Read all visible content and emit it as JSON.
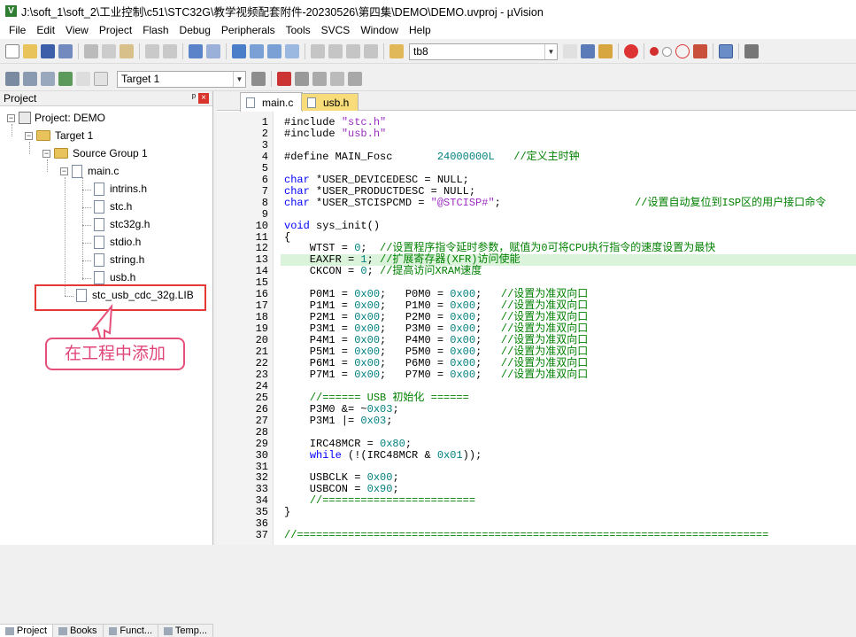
{
  "window": {
    "title": "J:\\soft_1\\soft_2\\工业控制\\c51\\STC32G\\教学视频配套附件-20230526\\第四集\\DEMO\\DEMO.uvproj - µVision",
    "app_icon": "V"
  },
  "menu": [
    "File",
    "Edit",
    "View",
    "Project",
    "Flash",
    "Debug",
    "Peripherals",
    "Tools",
    "SVCS",
    "Window",
    "Help"
  ],
  "toolbar1": {
    "find_combo": "tb8"
  },
  "toolbar2": {
    "target_combo": "Target 1"
  },
  "project_panel": {
    "title": "Project",
    "pin": "ᵖ",
    "close": "×",
    "tree": {
      "root": "Project: DEMO",
      "target": "Target 1",
      "group": "Source Group 1",
      "main_file": "main.c",
      "includes": [
        "intrins.h",
        "stc.h",
        "stc32g.h",
        "stdio.h",
        "string.h",
        "usb.h"
      ],
      "lib_file": "stc_usb_cdc_32g.LIB"
    },
    "annotation": "在工程中添加",
    "bottom_tabs": [
      "Project",
      "Books",
      "Funct...",
      "Temp..."
    ]
  },
  "editor": {
    "tabs": [
      {
        "label": "main.c",
        "active": true
      },
      {
        "label": "usb.h",
        "active": false
      }
    ],
    "highlight_line": 13,
    "lines": [
      {
        "n": "1",
        "html": "#include <span class=\"str\">\"stc.h\"</span>"
      },
      {
        "n": "2",
        "html": "#include <span class=\"str\">\"usb.h\"</span>"
      },
      {
        "n": "3",
        "html": ""
      },
      {
        "n": "4",
        "html": "#define MAIN_Fosc       <span class=\"num\">24000000L</span>   <span class=\"cm\">//定义主时钟</span>"
      },
      {
        "n": "5",
        "html": ""
      },
      {
        "n": "6",
        "html": "<span class=\"kw\">char</span> *USER_DEVICEDESC = NULL;"
      },
      {
        "n": "7",
        "html": "<span class=\"kw\">char</span> *USER_PRODUCTDESC = NULL;"
      },
      {
        "n": "8",
        "html": "<span class=\"kw\">char</span> *USER_STCISPCMD = <span class=\"str\">\"@STCISP#\"</span>;                     <span class=\"cm\">//设置自动复位到ISP区的用户接口命令</span>"
      },
      {
        "n": "9",
        "html": ""
      },
      {
        "n": "10",
        "html": "<span class=\"kw\">void</span> sys_init()"
      },
      {
        "n": "11",
        "html": "{"
      },
      {
        "n": "12",
        "html": "    WTST = <span class=\"num\">0</span>;  <span class=\"cm\">//设置程序指令延时参数，赋值为0可将CPU执行指令的速度设置为最快</span>"
      },
      {
        "n": "13",
        "html": "    EAXFR = <span class=\"num\">1</span>; <span class=\"cm\">//扩展寄存器(XFR)访问使能</span>"
      },
      {
        "n": "14",
        "html": "    CKCON = <span class=\"num\">0</span>; <span class=\"cm\">//提高访问XRAM速度</span>"
      },
      {
        "n": "15",
        "html": ""
      },
      {
        "n": "16",
        "html": "    P0M1 = <span class=\"num\">0x00</span>;   P0M0 = <span class=\"num\">0x00</span>;   <span class=\"cm\">//设置为准双向口</span>"
      },
      {
        "n": "17",
        "html": "    P1M1 = <span class=\"num\">0x00</span>;   P1M0 = <span class=\"num\">0x00</span>;   <span class=\"cm\">//设置为准双向口</span>"
      },
      {
        "n": "18",
        "html": "    P2M1 = <span class=\"num\">0x00</span>;   P2M0 = <span class=\"num\">0x00</span>;   <span class=\"cm\">//设置为准双向口</span>"
      },
      {
        "n": "19",
        "html": "    P3M1 = <span class=\"num\">0x00</span>;   P3M0 = <span class=\"num\">0x00</span>;   <span class=\"cm\">//设置为准双向口</span>"
      },
      {
        "n": "20",
        "html": "    P4M1 = <span class=\"num\">0x00</span>;   P4M0 = <span class=\"num\">0x00</span>;   <span class=\"cm\">//设置为准双向口</span>"
      },
      {
        "n": "21",
        "html": "    P5M1 = <span class=\"num\">0x00</span>;   P5M0 = <span class=\"num\">0x00</span>;   <span class=\"cm\">//设置为准双向口</span>"
      },
      {
        "n": "22",
        "html": "    P6M1 = <span class=\"num\">0x00</span>;   P6M0 = <span class=\"num\">0x00</span>;   <span class=\"cm\">//设置为准双向口</span>"
      },
      {
        "n": "23",
        "html": "    P7M1 = <span class=\"num\">0x00</span>;   P7M0 = <span class=\"num\">0x00</span>;   <span class=\"cm\">//设置为准双向口</span>"
      },
      {
        "n": "24",
        "html": ""
      },
      {
        "n": "25",
        "html": "    <span class=\"cm\">//====== USB 初始化 ======</span>"
      },
      {
        "n": "26",
        "html": "    P3M0 &amp;= ~<span class=\"num\">0x03</span>;"
      },
      {
        "n": "27",
        "html": "    P3M1 |= <span class=\"num\">0x03</span>;"
      },
      {
        "n": "28",
        "html": ""
      },
      {
        "n": "29",
        "html": "    IRC48MCR = <span class=\"num\">0x80</span>;"
      },
      {
        "n": "30",
        "html": "    <span class=\"kw\">while</span> (!(IRC48MCR &amp; <span class=\"num\">0x01</span>));"
      },
      {
        "n": "31",
        "html": ""
      },
      {
        "n": "32",
        "html": "    USBCLK = <span class=\"num\">0x00</span>;"
      },
      {
        "n": "33",
        "html": "    USBCON = <span class=\"num\">0x90</span>;"
      },
      {
        "n": "34",
        "html": "    <span class=\"cm\">//========================</span>"
      },
      {
        "n": "35",
        "html": "}"
      },
      {
        "n": "36",
        "html": ""
      },
      {
        "n": "37",
        "html": "<span class=\"cm\">//==========================================================================</span>"
      }
    ]
  },
  "colors": {
    "accent": "#2e7d32",
    "annotation": "#e53935",
    "callout_text": "#e0457a",
    "tab_inactive": "#f8dc7a",
    "line_highlight": "#dbf3db"
  }
}
